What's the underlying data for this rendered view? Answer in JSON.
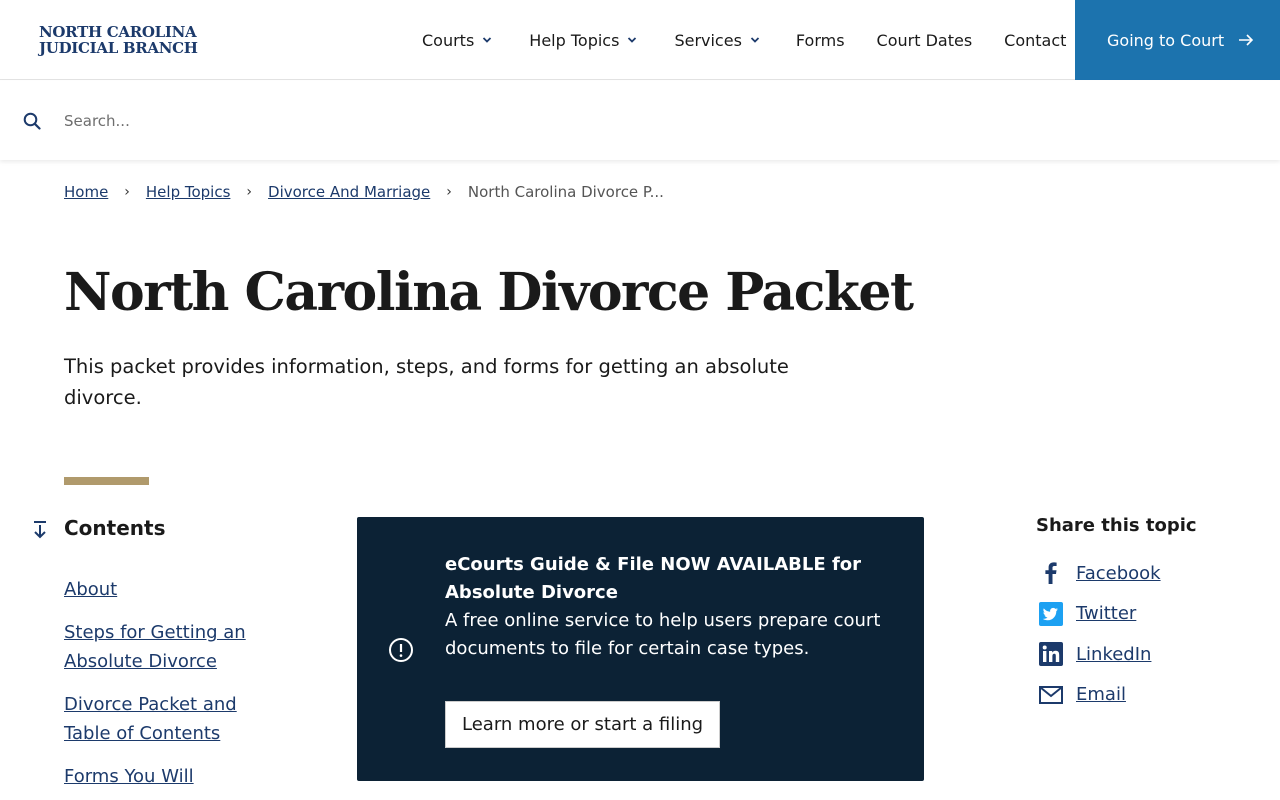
{
  "header": {
    "logo_line1": "NORTH CAROLINA",
    "logo_line2": "JUDICIAL BRANCH",
    "nav": {
      "courts": "Courts",
      "help_topics": "Help Topics",
      "services": "Services",
      "forms": "Forms",
      "court_dates": "Court Dates",
      "contact": "Contact"
    },
    "cta_label": "Going to Court"
  },
  "search": {
    "placeholder": "Search...",
    "value": ""
  },
  "breadcrumb": {
    "home": "Home",
    "help_topics": "Help Topics",
    "divorce_marriage": "Divorce And Marriage",
    "current": "North Carolina Divorce P..."
  },
  "page": {
    "title": "North Carolina Divorce Packet",
    "lede": "This packet provides information, steps, and forms for getting an absolute divorce."
  },
  "contents": {
    "title": "Contents",
    "items": [
      {
        "label": "About"
      },
      {
        "label": "Steps for Getting an Absolute Divorce"
      },
      {
        "label": "Divorce Packet and Table of Contents"
      },
      {
        "label": "Forms You Will"
      }
    ]
  },
  "notice": {
    "heading": "eCourts Guide & File NOW AVAILABLE for Absolute Divorce",
    "body": "A free online service to help users prepare court documents to file for certain case types.",
    "button_label": "Learn more or start a filing"
  },
  "share": {
    "title": "Share this topic",
    "items": [
      {
        "label": "Facebook",
        "icon": "facebook-icon"
      },
      {
        "label": "Twitter",
        "icon": "twitter-icon"
      },
      {
        "label": "LinkedIn",
        "icon": "linkedin-icon"
      },
      {
        "label": "Email",
        "icon": "email-icon"
      }
    ]
  },
  "colors": {
    "brand_navy": "#1c3a6b",
    "cta_blue": "#1c73ae",
    "notice_bg": "#0c2235",
    "accent_gold": "#b09a6c"
  }
}
